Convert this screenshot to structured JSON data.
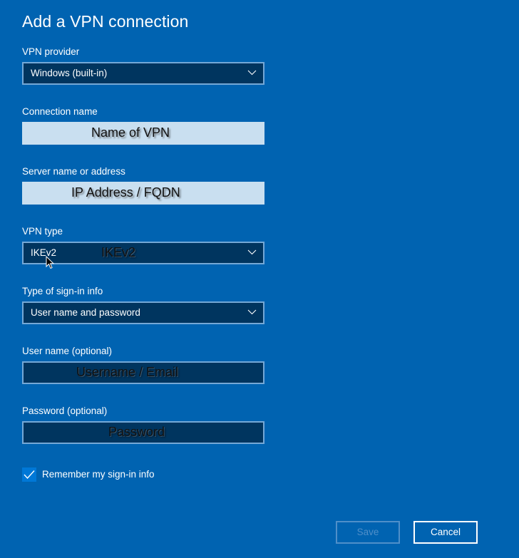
{
  "dialog": {
    "title": "Add a VPN connection"
  },
  "fields": {
    "vpn_provider": {
      "label": "VPN provider",
      "value": "Windows (built-in)",
      "icon": "chevron-down-icon"
    },
    "connection_name": {
      "label": "Connection name",
      "overlay": "Name of VPN"
    },
    "server": {
      "label": "Server name or address",
      "overlay": "IP Address / FQDN"
    },
    "vpn_type": {
      "label": "VPN type",
      "value": "IKEv2",
      "overlay": "IKEv2",
      "icon": "chevron-down-icon"
    },
    "sign_in_type": {
      "label": "Type of sign-in info",
      "value": "User name and password",
      "icon": "chevron-down-icon"
    },
    "username": {
      "label": "User name (optional)",
      "overlay": "Username / Email"
    },
    "password": {
      "label": "Password (optional)",
      "overlay": "Password"
    }
  },
  "remember": {
    "label": "Remember my sign-in info",
    "checked": true,
    "icon": "checkmark-icon"
  },
  "buttons": {
    "save": "Save",
    "cancel": "Cancel"
  },
  "colors": {
    "background": "#0063b1",
    "field_dark": "#00355f",
    "field_light": "#c9dff0",
    "field_border": "#75a8d6",
    "checkbox": "#0078d7",
    "save_disabled": "#4f8fc9"
  }
}
